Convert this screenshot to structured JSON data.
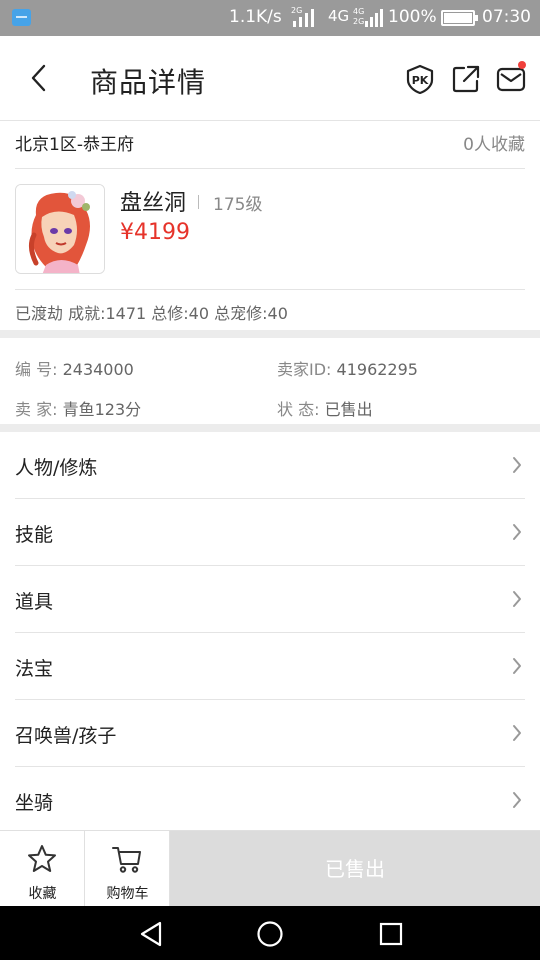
{
  "status_bar": {
    "speed": "1.1K/s",
    "net1": "2G",
    "net2": "4G",
    "net3": "4G",
    "net4": "2G",
    "battery": "100%",
    "time": "07:30"
  },
  "header": {
    "title": "商品详情",
    "pk_icon_text": "PK"
  },
  "product": {
    "server": "北京1区-恭王府",
    "favorites": "0人收藏",
    "name": "盘丝洞",
    "level": "175级",
    "price": "¥4199",
    "stats": "已渡劫 成就:1471 总修:40 总宠修:40"
  },
  "details": {
    "id_label": "编  号: ",
    "id_value": "2434000",
    "seller_id_label": "卖家ID: ",
    "seller_id_value": "41962295",
    "seller_label": "卖  家: ",
    "seller_value": "青鱼123分",
    "status_label": "状  态: ",
    "status_value": "已售出"
  },
  "menu": [
    {
      "label": "人物/修炼"
    },
    {
      "label": "技能"
    },
    {
      "label": "道具"
    },
    {
      "label": "法宝"
    },
    {
      "label": "召唤兽/孩子"
    },
    {
      "label": "坐骑"
    }
  ],
  "bottom": {
    "favorite_label": "收藏",
    "cart_label": "购物车",
    "sold_label": "已售出"
  },
  "colors": {
    "price": "#e6332a",
    "notification_dot": "#f0403c",
    "status_bar": "#9a9a9a",
    "sold_button": "#dcdcdc"
  }
}
